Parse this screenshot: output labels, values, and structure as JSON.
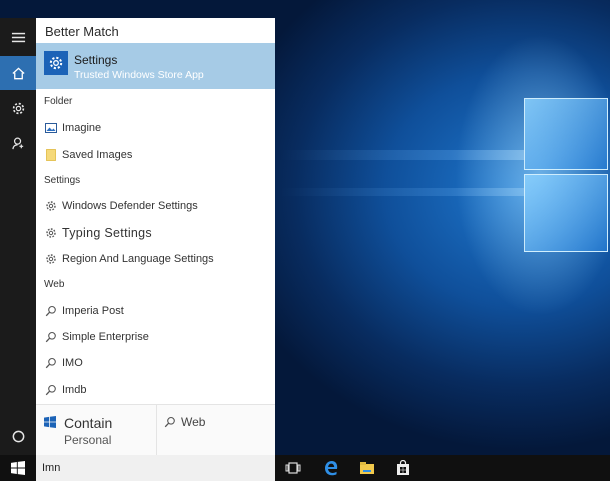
{
  "best_match": {
    "header": "Better Match",
    "title": "Settings",
    "subtitle": "Trusted Windows Store App"
  },
  "folder": {
    "header": "Folder",
    "items": [
      "Imagine",
      "Saved Images"
    ]
  },
  "settings": {
    "header": "Settings",
    "items": [
      "Windows Defender Settings",
      "Typing Settings",
      "Region And Language Settings"
    ]
  },
  "web": {
    "header": "Web",
    "items": [
      "Imperia Post",
      "Simple Enterprise",
      "IMO",
      "Imdb"
    ]
  },
  "bottom": {
    "contain_title": "Contain",
    "contain_sub": "Personal",
    "web_label": "Web"
  },
  "taskbar": {
    "search_query": "Imn"
  },
  "icons": {
    "rail": [
      "hamburger-icon",
      "home-icon",
      "gear-icon",
      "feedback-icon",
      "power-icon"
    ],
    "taskbar": [
      "windows-icon",
      "task-view-icon",
      "edge-icon",
      "file-explorer-icon",
      "store-icon"
    ]
  },
  "colors": {
    "accent": "#2d6fb1",
    "best_match_bg": "#a6cbe6",
    "app_icon_bg": "#1c63b7"
  }
}
